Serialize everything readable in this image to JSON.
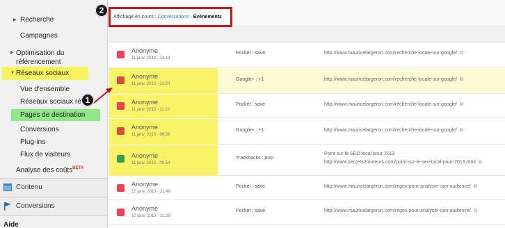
{
  "sidebar": {
    "items": [
      {
        "label": "Recherche"
      },
      {
        "label": "Campagnes"
      },
      {
        "label": "Optimisation du référencement"
      },
      {
        "label": "Réseaux sociaux"
      },
      {
        "label": "Vue d'ensemble"
      },
      {
        "label": "Réseaux sociaux réf"
      },
      {
        "label": "Pages de destination"
      },
      {
        "label": "Conversions"
      },
      {
        "label": "Plug-ins"
      },
      {
        "label": "Flux de visiteurs"
      },
      {
        "label": "Analyse des coûts"
      }
    ],
    "beta_label": "BÊTA",
    "sections": [
      {
        "label": "Contenu",
        "icon": "content-icon"
      },
      {
        "label": "Conversions",
        "icon": "flag-icon"
      }
    ],
    "aide_label": "Aide"
  },
  "breadcrumb": {
    "prefix": "Affichage en cours :",
    "link": "Conversations",
    "current": "Événements"
  },
  "rows": [
    {
      "name": "Anonyme",
      "time": "11 janv. 2013 - 14:19",
      "action": "Pocket : save",
      "url": "http://www.mauricelargeron.com/recherche-locale-sur-google/",
      "source": "pocket-icon"
    },
    {
      "name": "Anonyme",
      "time": "11 janv. 2013 - 11:20",
      "action": "Google+ : +1",
      "url": "http://www.mauricelargeron.com/recherche-locale-sur-google/",
      "source": "google-plus-icon"
    },
    {
      "name": "Anonyme",
      "time": "11 janv. 2013 - 11:10",
      "action": "Pocket : save",
      "url": "http://www.mauricelargeron.com/recherche-locale-sur-google/",
      "source": "pocket-icon"
    },
    {
      "name": "Anonyme",
      "time": "11 janv. 2013 - 09:58",
      "action": "Google+ : +1",
      "url": "http://www.mauricelargeron.com/recherche-locale-sur-google/",
      "source": "google-plus-icon"
    },
    {
      "name": "Anonyme",
      "time": "11 janv. 2013 - 09:54",
      "action": "Trackbacks : post",
      "url_title": "Point sur le SEO local pour 2013",
      "url": "http://www.secrets2moteurs.com/point-sur-le-seo-local-pour-2013.html",
      "source": "trackback-icon"
    },
    {
      "name": "Anonyme",
      "time": "10 janv. 2013 - 21:49",
      "action": "Pocket : save",
      "url": "http://www.mauricelargeron.com/regex-pour-analyser-son-audience/",
      "source": "pocket-icon"
    },
    {
      "name": "Anonyme",
      "time": "10 janv. 2013 - 21:39",
      "action": "Pocket : save",
      "url": "http://www.mauricelargeron.com/regex-pour-analyser-son-audience/",
      "source": "pocket-icon"
    }
  ],
  "badges": {
    "one": "1",
    "two": "2"
  },
  "colors": {
    "highlight_yellow": "#f7f35a",
    "highlight_green": "#8ee886",
    "callout_red": "#d0181e",
    "link_blue": "#3b78c4"
  }
}
